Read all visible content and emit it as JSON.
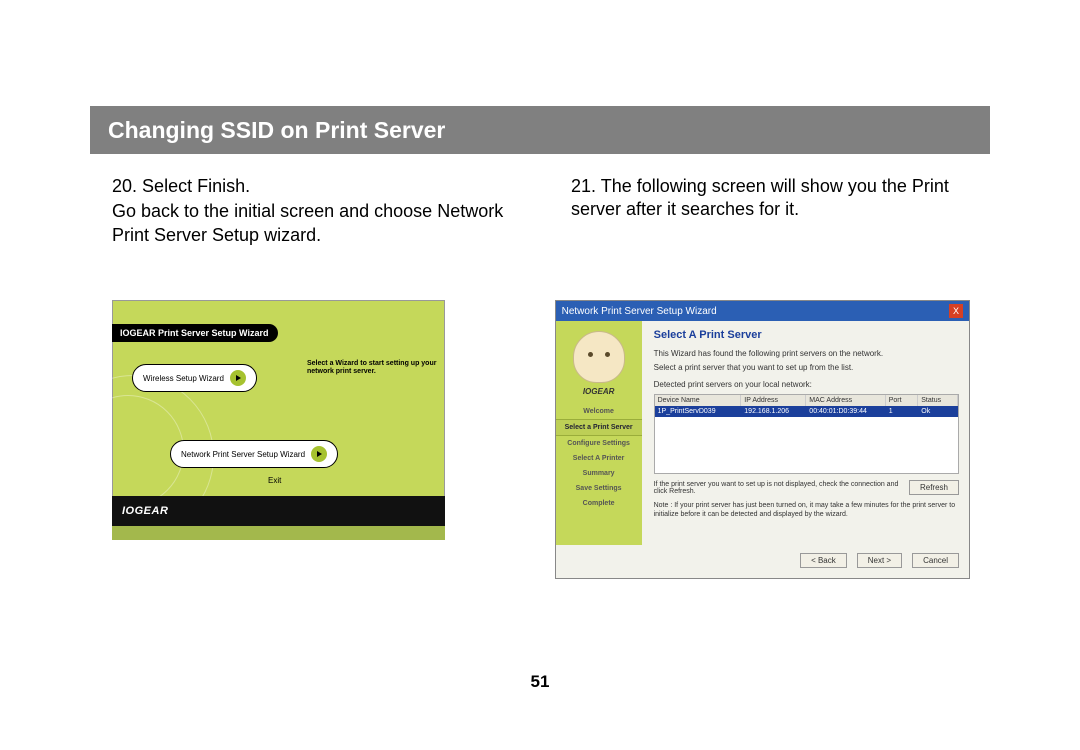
{
  "header": {
    "title": "Changing SSID on Print Server"
  },
  "steps": {
    "left": {
      "num": "20.",
      "title": "Select Finish.",
      "sub": "Go back to the initial screen and choose Network Print Server Setup wizard."
    },
    "right": {
      "num": "21.",
      "title": "The following screen will show you the Print server after it searches for it."
    }
  },
  "fig_left": {
    "banner": "IOGEAR Print Server Setup Wizard",
    "pill1": "Wireless Setup Wizard",
    "pill2": "Network Print Server Setup Wizard",
    "hint": "Select a Wizard to start setting up your network print server.",
    "exit": "Exit",
    "brand": "IOGEAR"
  },
  "dialog": {
    "title": "Network Print Server Setup Wizard",
    "close": "X",
    "brand": "IOGEAR",
    "side": [
      "Welcome",
      "Select a Print Server",
      "Configure Settings",
      "Select A Printer",
      "Summary",
      "Save Settings",
      "Complete"
    ],
    "heading": "Select A Print Server",
    "intro1": "This Wizard has found the following print servers on the network.",
    "intro2": "Select a print server that you want to set up from the list.",
    "detected": "Detected print servers on your local network:",
    "columns": [
      "Device Name",
      "IP Address",
      "MAC Address",
      "Port",
      "Status"
    ],
    "row": [
      "1P_PrintServD039",
      "192.168.1.206",
      "00:40:01:D0:39:44",
      "1",
      "Ok"
    ],
    "refresh_hint": "If the print server you want to set up is not displayed, check the connection and click Refresh.",
    "refresh": "Refresh",
    "note": "Note : If your print server has just been turned on, it may take a few minutes for the print server to initialize before it can be detected and displayed by the wizard.",
    "back": "< Back",
    "next": "Next >",
    "cancel": "Cancel"
  },
  "page_number": "51"
}
